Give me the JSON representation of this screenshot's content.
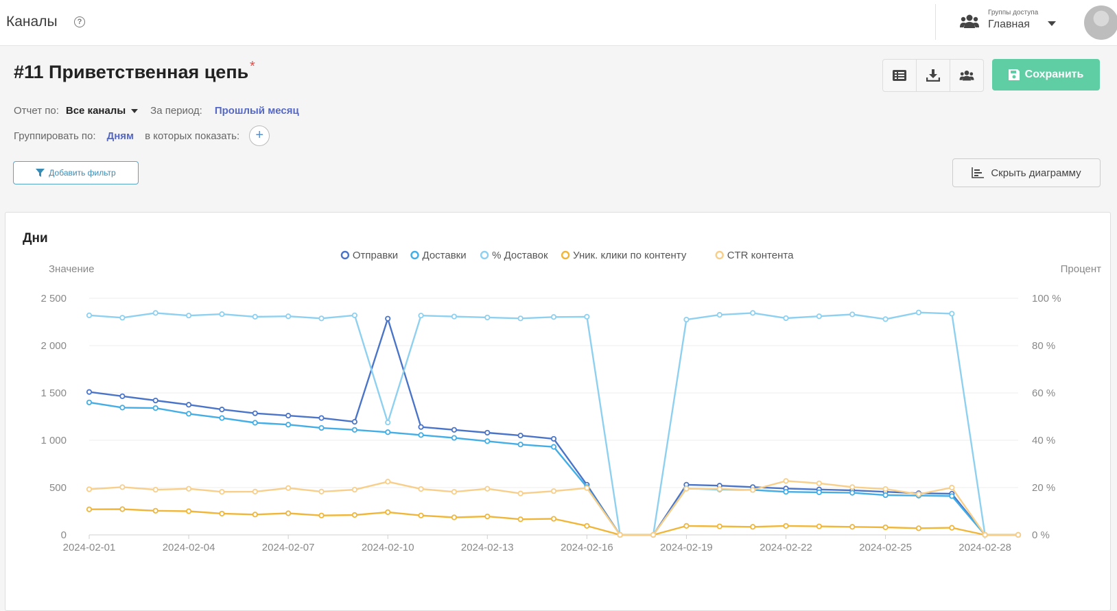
{
  "header": {
    "app_title": "Каналы",
    "help_icon": "help-circle-icon",
    "access_groups_caption": "Группы доступа",
    "access_groups_value": "Главная"
  },
  "page": {
    "title": "#11 Приветственная цепь",
    "unsaved_marker": "*",
    "save_label": "Сохранить"
  },
  "filters": {
    "report_by_label": "Отчет по:",
    "report_by_value": "Все каналы",
    "period_label": "За период:",
    "period_value": "Прошлый месяц",
    "group_by_label": "Группировать по:",
    "group_by_value": "Дням",
    "show_in_label": "в которых показать:",
    "add_filter_label": "Добавить фильтр",
    "hide_chart_label": "Скрыть диаграмму"
  },
  "chart_panel": {
    "title": "Дни"
  },
  "colors": {
    "accent_green": "#5fcea5",
    "link_blue": "#5568c4",
    "s_sends": "#4a74c8",
    "s_deliveries": "#43ade6",
    "s_pct_deliv": "#8ed0f0",
    "s_clicks": "#f0b63a",
    "s_ctr": "#f8cf8a"
  },
  "chart_data": {
    "type": "line",
    "ylabel": "Значение",
    "y2label": "Процент",
    "ylim": [
      0,
      2500
    ],
    "y2lim": [
      0,
      100
    ],
    "y_ticks": [
      "0",
      "500",
      "1 000",
      "1 500",
      "2 000",
      "2 500"
    ],
    "y2_ticks": [
      "0 %",
      "20 %",
      "40 %",
      "60 %",
      "80 %",
      "100 %"
    ],
    "x_ticks": [
      "2024-02-01",
      "2024-02-04",
      "2024-02-07",
      "2024-02-10",
      "2024-02-13",
      "2024-02-16",
      "2024-02-19",
      "2024-02-22",
      "2024-02-25",
      "2024-02-28"
    ],
    "x": [
      "2024-02-01",
      "2024-02-02",
      "2024-02-03",
      "2024-02-04",
      "2024-02-05",
      "2024-02-06",
      "2024-02-07",
      "2024-02-08",
      "2024-02-09",
      "2024-02-10",
      "2024-02-11",
      "2024-02-12",
      "2024-02-13",
      "2024-02-14",
      "2024-02-15",
      "2024-02-16",
      "2024-02-17",
      "2024-02-18",
      "2024-02-19",
      "2024-02-20",
      "2024-02-21",
      "2024-02-22",
      "2024-02-23",
      "2024-02-24",
      "2024-02-25",
      "2024-02-26",
      "2024-02-27",
      "2024-02-28",
      "2024-02-29"
    ],
    "legend_position": "top-center",
    "grid": true,
    "series": [
      {
        "name": "Отправки",
        "axis": "left",
        "color": "#4a74c8",
        "values": [
          1510,
          1465,
          1420,
          1375,
          1325,
          1285,
          1260,
          1235,
          1195,
          2285,
          1140,
          1110,
          1080,
          1050,
          1015,
          530,
          0,
          0,
          530,
          520,
          505,
          490,
          480,
          470,
          455,
          440,
          435,
          0,
          0
        ]
      },
      {
        "name": "Доставки",
        "axis": "left",
        "color": "#43ade6",
        "values": [
          1400,
          1345,
          1340,
          1280,
          1235,
          1185,
          1165,
          1130,
          1110,
          1085,
          1055,
          1025,
          990,
          955,
          930,
          505,
          0,
          0,
          490,
          480,
          475,
          455,
          450,
          445,
          420,
          415,
          410,
          0,
          0
        ]
      },
      {
        "name": "% Доставок",
        "axis": "right",
        "color": "#8ed0f0",
        "values": [
          92.8,
          91.8,
          93.8,
          92.7,
          93.3,
          92.2,
          92.4,
          91.5,
          92.8,
          47.5,
          92.7,
          92.3,
          91.9,
          91.5,
          92.1,
          92.2,
          0,
          0,
          91.0,
          93.0,
          93.8,
          91.6,
          92.4,
          93.2,
          91.2,
          94.0,
          93.5,
          0,
          0
        ]
      },
      {
        "name": "Уник. клики по контенту",
        "axis": "left",
        "color": "#f0b63a",
        "values": [
          270,
          272,
          255,
          250,
          225,
          215,
          228,
          205,
          210,
          240,
          205,
          185,
          195,
          165,
          170,
          95,
          0,
          0,
          95,
          90,
          85,
          95,
          90,
          85,
          80,
          70,
          75,
          0,
          0
        ]
      },
      {
        "name": "CTR контента",
        "axis": "right",
        "color": "#f8cf8a",
        "values": [
          19.3,
          20.2,
          19.1,
          19.5,
          18.2,
          18.3,
          19.8,
          18.3,
          19.1,
          22.5,
          19.4,
          18.2,
          19.5,
          17.5,
          18.5,
          19.8,
          0,
          0,
          19.5,
          19.4,
          19.0,
          22.8,
          21.8,
          20.2,
          19.4,
          17.2,
          20.0,
          0,
          0
        ]
      }
    ]
  }
}
